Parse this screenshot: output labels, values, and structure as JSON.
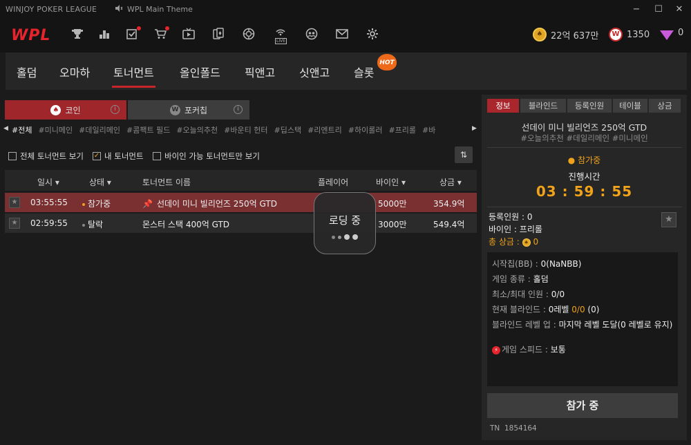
{
  "app_title": "WINJOY POKER LEAGUE",
  "music_title": "WPL Main Theme",
  "logo_text": "WPL",
  "currencies": {
    "coin": "22억 637만",
    "w_point": "1350",
    "gem": "0"
  },
  "game_tabs": [
    "홀덤",
    "오마하",
    "토너먼트",
    "올인폴드",
    "픽앤고",
    "싯앤고",
    "슬롯"
  ],
  "hot_badge": "HOT",
  "currency_tabs": {
    "coin": "코인",
    "pokerchip": "포커칩"
  },
  "tags": [
    "#전체",
    "#미니메인",
    "#데일리메인",
    "#콤팩트 필드",
    "#오늘의추천",
    "#바운티 헌터",
    "#딥스택",
    "#리엔트리",
    "#하이롤러",
    "#프리롤",
    "#바"
  ],
  "filters": {
    "all": "전체 토너먼트 보기",
    "mine": "내 토너먼트",
    "buyin_only": "바이인 가능 토너먼트만 보기"
  },
  "table": {
    "headers": {
      "time": "일시",
      "status": "상태",
      "name": "토너먼트 이름",
      "players": "플레이어",
      "buyin": "바이인",
      "prize": "상금"
    },
    "rows": [
      {
        "time": "03:55:55",
        "status": "참가중",
        "name": "선데이 미니 빌리언즈 250억 GTD",
        "buyin": "5000만",
        "prize": "354.9억"
      },
      {
        "time": "02:59:55",
        "status": "탈락",
        "name": "몬스터 스택 400억 GTD",
        "buyin": "3000만",
        "prize": "549.4억"
      }
    ]
  },
  "loading": "로딩 중",
  "detail": {
    "tabs": [
      "정보",
      "블라인드",
      "등록인원",
      "테이블",
      "상금"
    ],
    "title": "선데이 미니 빌리언즈 250억 GTD",
    "tags": "#오늘의추천 #데일리메인 #미니메인",
    "status": "참가중",
    "timer_label": "진행시간",
    "timer": "03 : 59 : 55",
    "registered": "등록인원 : 0",
    "buyin": "바이인 : 프리롤",
    "total_prize_label": "총 상금 :",
    "total_prize": "0",
    "starting_chips_label": "시작칩(BB) : ",
    "starting_chips": "0(NaNBB)",
    "game_type_label": "게임 종류 : ",
    "game_type": "홀덤",
    "min_max_label": "최소/최대 인원 : ",
    "min_max": "0/0",
    "current_blind_label": "현재 블라인드 : ",
    "current_blind_level": "0레벨",
    "current_blind_value": "0/0",
    "current_blind_ante": "(0)",
    "blind_levelup_label": "블라인드 레벨 업 : ",
    "blind_levelup": "마지막 레벨 도달(0 레벨로 유지)",
    "game_speed_label": "게임 스피드 : ",
    "game_speed": "보통",
    "join_button": "참가 중",
    "tn_label": "TN",
    "tn_value": "1854164"
  },
  "colors": {
    "accent_red": "#c9262c",
    "gold": "#f0a31a",
    "selected_row": "#7a2f31"
  }
}
